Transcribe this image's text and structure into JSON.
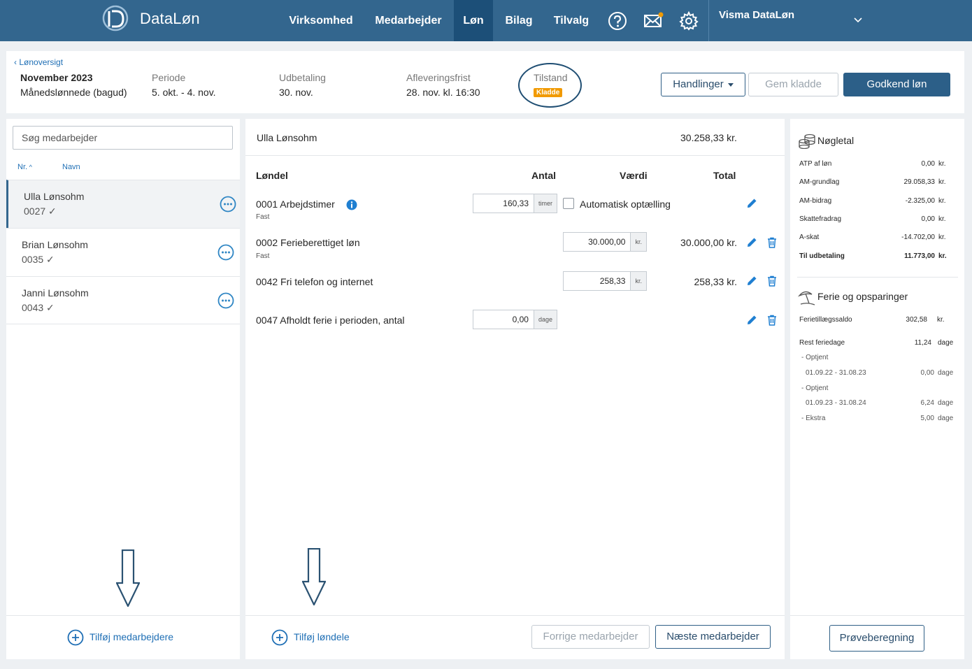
{
  "nav": {
    "app_name": "DataLøn",
    "items": [
      {
        "label": "Virksomhed"
      },
      {
        "label": "Medarbejder"
      },
      {
        "label": "Løn"
      },
      {
        "label": "Bilag"
      },
      {
        "label": "Tilvalg"
      }
    ],
    "active_item": "Løn",
    "company": "Visma DataLøn",
    "icons": [
      "help-icon",
      "mail-icon",
      "settings-icon",
      "chevron-down-icon"
    ],
    "accent_color": "#33668e"
  },
  "header": {
    "back_link": "Lønoversigt",
    "month": "November 2023",
    "salary_type": "Månedslønnede (bagud)",
    "period_label": "Periode",
    "period_value": "5. okt. - 4. nov.",
    "payout_label": "Udbetaling",
    "payout_value": "30. nov.",
    "deadline_label": "Afleveringsfrist",
    "deadline_value": "28. nov. kl. 16:30",
    "status_label": "Tilstand",
    "status_badge": "Kladde",
    "status_color": "#f19a00",
    "actions_label": "Handlinger",
    "save_draft_label": "Gem kladde",
    "approve_label": "Godkend løn"
  },
  "employees": {
    "search_placeholder": "Søg medarbejder",
    "sort_nr": "Nr.",
    "sort_name": "Navn",
    "list": [
      {
        "name": "Ulla Lønsohm",
        "number": "0027",
        "selected": true
      },
      {
        "name": "Brian Lønsohm",
        "number": "0035",
        "selected": false
      },
      {
        "name": "Janni Lønsohm",
        "number": "0043",
        "selected": false
      }
    ],
    "add_label": "Tilføj medarbejdere"
  },
  "payslip": {
    "employee": "Ulla Lønsohm",
    "total": "30.258,33 kr.",
    "columns": {
      "item": "Løndel",
      "quantity": "Antal",
      "value": "Værdi",
      "total": "Total"
    },
    "lines": [
      {
        "name": "0001 Arbejdstimer",
        "sub": "Fast",
        "quantity": "160,33",
        "quantity_unit": "timer",
        "auto_label": "Automatisk optælling"
      },
      {
        "name": "0002 Ferieberettiget løn",
        "sub": "Fast",
        "value": "30.000,00",
        "value_unit": "kr.",
        "total": "30.000,00 kr."
      },
      {
        "name": "0042 Fri telefon og internet",
        "value": "258,33",
        "value_unit": "kr.",
        "total": "258,33 kr."
      },
      {
        "name": "0047 Afholdt ferie i perioden, antal",
        "quantity": "0,00",
        "quantity_unit": "dage"
      }
    ],
    "add_label": "Tilføj løndele",
    "prev_label": "Forrige medarbejder",
    "next_label": "Næste medarbejder"
  },
  "keyfigures": {
    "title": "Nøgletal",
    "rows": [
      {
        "label": "ATP af løn",
        "value": "0,00",
        "unit": "kr."
      },
      {
        "label": "AM-grundlag",
        "value": "29.058,33",
        "unit": "kr."
      },
      {
        "label": "AM-bidrag",
        "value": "-2.325,00",
        "unit": "kr."
      },
      {
        "label": "Skattefradrag",
        "value": "0,00",
        "unit": "kr."
      },
      {
        "label": "A-skat",
        "value": "-14.702,00",
        "unit": "kr."
      },
      {
        "label": "Til udbetaling",
        "value": "11.773,00",
        "unit": "kr."
      }
    ]
  },
  "vacation": {
    "title": "Ferie og opsparinger",
    "balance_label": "Ferietillægssaldo",
    "balance_value": "302,58",
    "balance_unit": "kr.",
    "rest_label": "Rest feriedage",
    "rest_value": "11,24",
    "rest_unit": "dage",
    "details": [
      {
        "label": "- Optjent"
      },
      {
        "label": "01.09.22 - 31.08.23",
        "value": "0,00",
        "unit": "dage"
      },
      {
        "label": "- Optjent"
      },
      {
        "label": "01.09.23 - 31.08.24",
        "value": "6,24",
        "unit": "dage"
      },
      {
        "label": "- Ekstra",
        "value": "5,00",
        "unit": "dage"
      }
    ],
    "trial_label": "Prøveberegning"
  }
}
